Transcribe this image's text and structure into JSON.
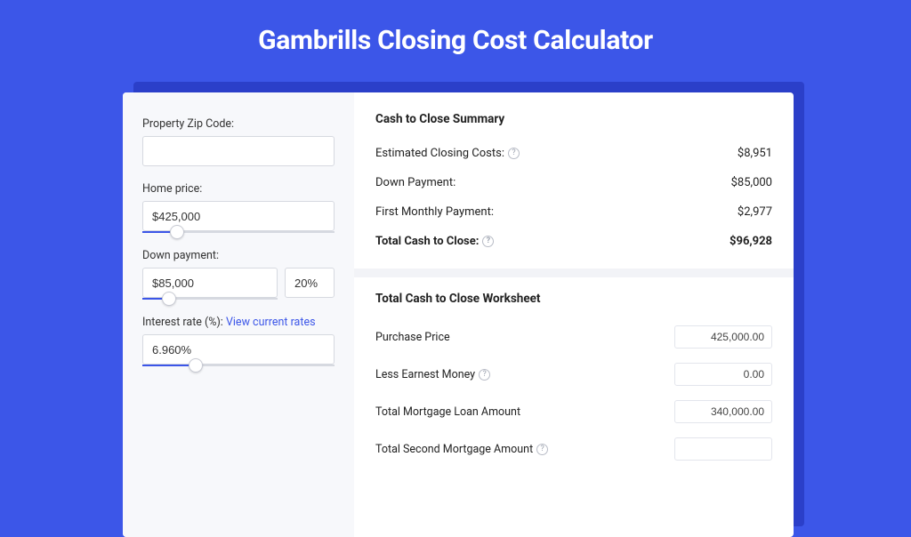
{
  "title": "Gambrills Closing Cost Calculator",
  "form": {
    "zip_label": "Property Zip Code:",
    "zip_value": "",
    "home_price_label": "Home price:",
    "home_price_value": "$425,000",
    "home_price_slider_pct": 18,
    "down_payment_label": "Down payment:",
    "down_payment_value": "$85,000",
    "down_payment_pct": "20%",
    "down_payment_slider_pct": 20,
    "rate_label_prefix": "Interest rate (%): ",
    "rate_link": "View current rates",
    "rate_value": "6.960%",
    "rate_slider_pct": 28
  },
  "summary": {
    "heading": "Cash to Close Summary",
    "rows": [
      {
        "label": "Estimated Closing Costs:",
        "help": true,
        "value": "$8,951",
        "bold": false
      },
      {
        "label": "Down Payment:",
        "help": false,
        "value": "$85,000",
        "bold": false
      },
      {
        "label": "First Monthly Payment:",
        "help": false,
        "value": "$2,977",
        "bold": false
      },
      {
        "label": "Total Cash to Close:",
        "help": true,
        "value": "$96,928",
        "bold": true
      }
    ]
  },
  "worksheet": {
    "heading": "Total Cash to Close Worksheet",
    "rows": [
      {
        "label": "Purchase Price",
        "help": false,
        "value": "425,000.00"
      },
      {
        "label": "Less Earnest Money",
        "help": true,
        "value": "0.00"
      },
      {
        "label": "Total Mortgage Loan Amount",
        "help": false,
        "value": "340,000.00"
      },
      {
        "label": "Total Second Mortgage Amount",
        "help": true,
        "value": ""
      }
    ]
  }
}
